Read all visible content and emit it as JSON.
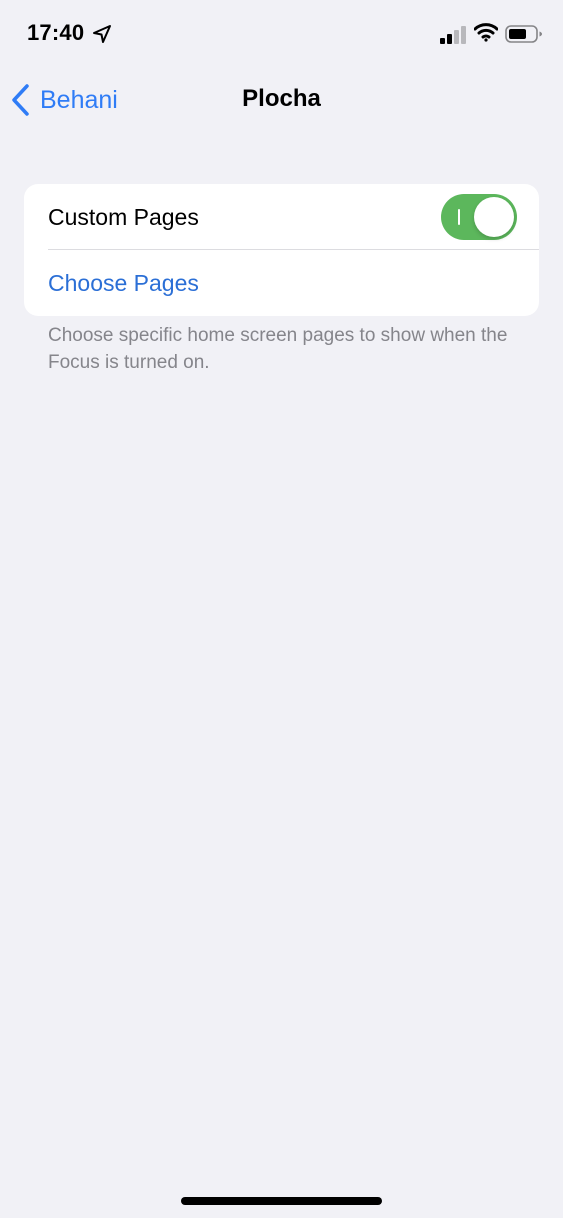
{
  "status_bar": {
    "time": "17:40",
    "location_icon": "location-arrow-icon",
    "signal_icon": "cellular-signal-icon",
    "wifi_icon": "wifi-icon",
    "battery_icon": "battery-icon"
  },
  "nav": {
    "back_label": "Behani",
    "title": "Plocha"
  },
  "settings": {
    "custom_pages_label": "Custom Pages",
    "custom_pages_enabled": true,
    "choose_pages_label": "Choose Pages",
    "footer": "Choose specific home screen pages to show when the Focus is turned on."
  },
  "colors": {
    "accent": "#2f7cf6",
    "toggle_on": "#5cb75c",
    "background": "#f1f1f6"
  }
}
